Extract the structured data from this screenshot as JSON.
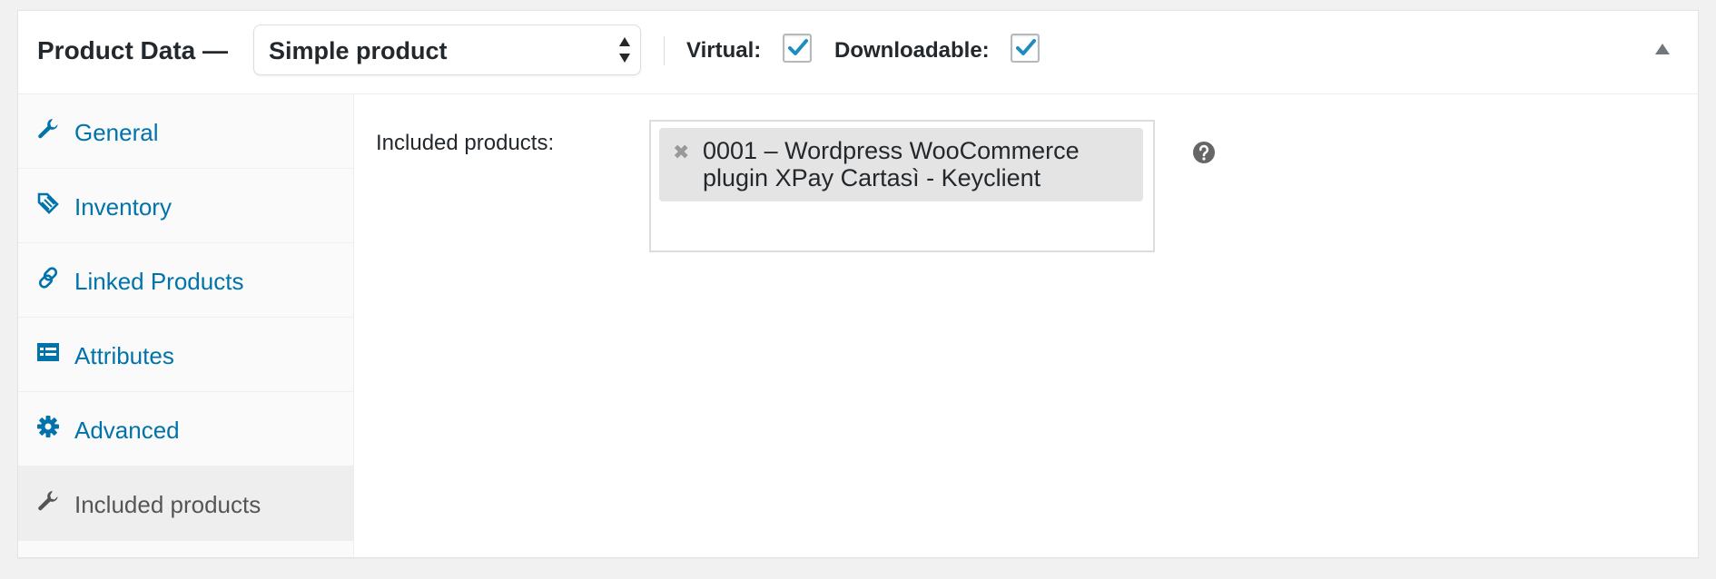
{
  "header": {
    "title": "Product Data —",
    "product_type": "Simple product",
    "virtual_label": "Virtual:",
    "virtual_checked": true,
    "downloadable_label": "Downloadable:",
    "downloadable_checked": true
  },
  "sidebar": {
    "tabs": [
      {
        "label": "General",
        "icon": "wrench-icon"
      },
      {
        "label": "Inventory",
        "icon": "tag-icon"
      },
      {
        "label": "Linked Products",
        "icon": "link-icon"
      },
      {
        "label": "Attributes",
        "icon": "table-icon"
      },
      {
        "label": "Advanced",
        "icon": "gear-icon"
      },
      {
        "label": "Included products",
        "icon": "wrench-icon",
        "active": true
      }
    ]
  },
  "main": {
    "field_label": "Included products:",
    "selected_items": [
      {
        "remove_glyph": "✖",
        "text": "0001 – Wordpress WooCommerce plugin XPay Cartasì - Keyclient"
      }
    ]
  },
  "colors": {
    "link": "#0073aa",
    "active_tab_bg": "#eeeeee",
    "chip_bg": "#e4e4e4"
  }
}
